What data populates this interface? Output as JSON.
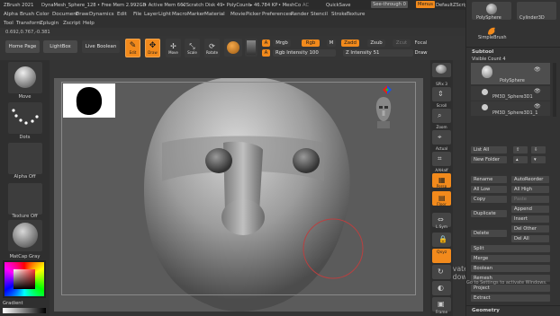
{
  "titlebar": {
    "app": "ZBrush 2021",
    "doc": "DynaMesh_Sphere_128",
    "free_mem": "• Free Mem 2.992GB",
    "active_mem": "• Active Mem 662",
    "scratch": "• Scratch Disk 49",
    "poly": "• PolyCount▸ 46.784 KP",
    "mesh": "• MeshCo",
    "ac": "AC",
    "quicksave": "QuickSave",
    "seethrough": "See-through 0",
    "menus_btn": "Menus",
    "default_script": "DefaultZScript"
  },
  "menus": {
    "row1": [
      "Alpha",
      "Brush",
      "Color",
      "Document",
      "Draw",
      "Dynamics",
      "Edit",
      "File",
      "Layer",
      "Light",
      "Macro",
      "Marker",
      "Material",
      "Movie",
      "Picker",
      "Preferences",
      "Render",
      "Stencil",
      "Stroke",
      "Texture"
    ],
    "row2": [
      "Tool",
      "Transform",
      "Zplugin",
      "Zscript",
      "Help"
    ]
  },
  "coord": "0.692,0.767,-0.381",
  "shelf": {
    "home": "Home Page",
    "lightbox": "LightBox",
    "live_boolean": "Live Boolean",
    "edit": "Edit",
    "draw": "Draw",
    "move": "Move",
    "scale": "Scale",
    "rotate": "Rotate",
    "a1": "A",
    "mrgb": "Mrgb",
    "rgb": "Rgb",
    "m": "M",
    "zadd": "Zadd",
    "zsub": "Zsub",
    "zcut": "Zcut",
    "rgb_intensity": "Rgb Intensity 100",
    "a2": "A",
    "z_intensity": "Z Intensity 51",
    "focal": "Focal",
    "draw_size": "Draw"
  },
  "lefttray": {
    "move": "Move",
    "dots": "Dots",
    "alpha_off": "Alpha Off",
    "texture_off": "Texture Off",
    "matcap": "MatCap Gray",
    "gradient": "Gradient"
  },
  "rstrip": [
    "SPix 3",
    "Scroll",
    "Zoom",
    "Actual",
    "AAHalf",
    "Persp",
    "Floor",
    "L.Sym",
    "",
    "Qxyz",
    "",
    "",
    "Frame",
    "Move"
  ],
  "rpanel": {
    "polysphere": "PolySphere",
    "cylinder": "Cylinder3D",
    "simplebrush": "SimpleBrush",
    "subtool": "Subtool",
    "visible_count": "Visible Count 4",
    "items": [
      "PolySphere",
      "PM3D_Sphere3D1",
      "PM3D_Sphere3D1_1"
    ],
    "list_all": "List All",
    "new_folder": "New Folder",
    "rename": "Rename",
    "autoreorder": "AutoReorder",
    "all_low": "All Low",
    "all_high": "All High",
    "copy": "Copy",
    "paste": "Paste",
    "append": "Append",
    "duplicate": "Duplicate",
    "insert": "Insert",
    "del_other": "Del Other",
    "delete": "Delete",
    "del_all": "Del All",
    "split": "Split",
    "merge": "Merge",
    "boolean": "Boolean",
    "remesh": "Remesh",
    "project": "Project",
    "extract": "Extract",
    "geometry": "Geometry"
  },
  "watermark": {
    "line1": "Activate Windows",
    "line2": "Go to Settings to activate Windows."
  },
  "colors": {
    "accent": "#f28a1c",
    "panel": "#333333",
    "canvas": "#5b5b5b"
  }
}
